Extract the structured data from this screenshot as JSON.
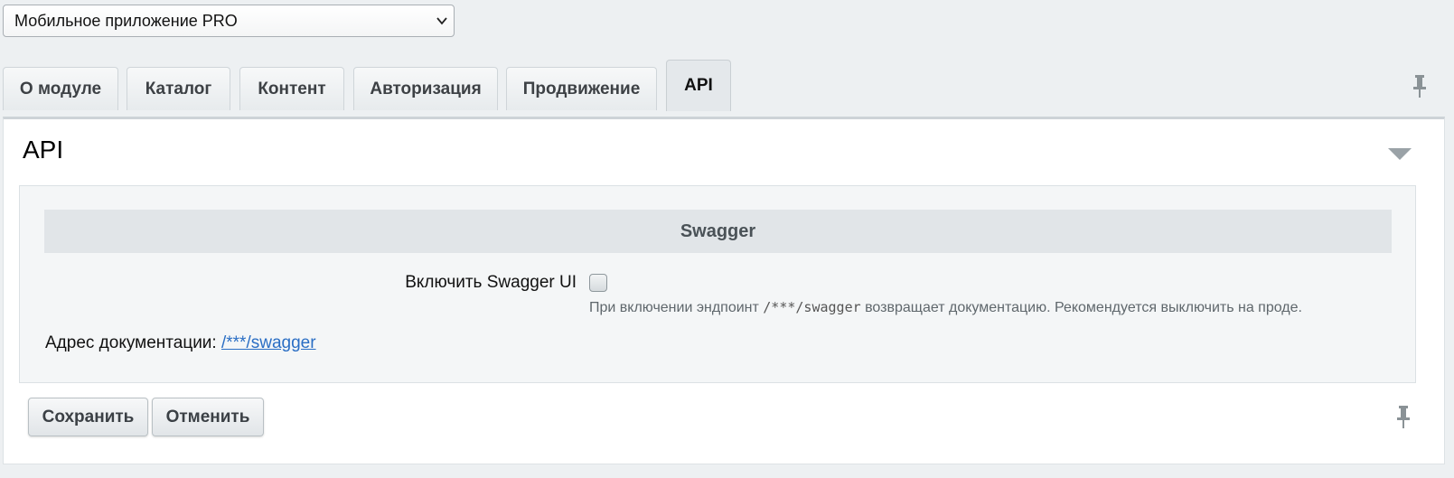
{
  "module_select": {
    "selected": "Мобильное приложение PRO"
  },
  "tabs": [
    {
      "label": "О модуле",
      "active": false
    },
    {
      "label": "Каталог",
      "active": false
    },
    {
      "label": "Контент",
      "active": false
    },
    {
      "label": "Авторизация",
      "active": false
    },
    {
      "label": "Продвижение",
      "active": false
    },
    {
      "label": "API",
      "active": true
    }
  ],
  "panel": {
    "title": "API",
    "section_title": "Swagger",
    "swagger_toggle": {
      "label": "Включить Swagger UI",
      "checked": false,
      "hint_before": "При включении эндпоинт ",
      "hint_code": "/***/swagger",
      "hint_after": " возвращает документацию. Рекомендуется выключить на проде."
    },
    "docs": {
      "label": "Адрес документации: ",
      "link_text": "/***/swagger"
    }
  },
  "buttons": {
    "save": "Сохранить",
    "cancel": "Отменить"
  },
  "icons": {
    "select_arrow": "chevron-down-icon",
    "pin": "pin-icon",
    "collapse": "triangle-down-icon"
  },
  "colors": {
    "page_bg": "#edf0f2",
    "link": "#2a6ec4",
    "section_bg": "#e1e5e8"
  }
}
